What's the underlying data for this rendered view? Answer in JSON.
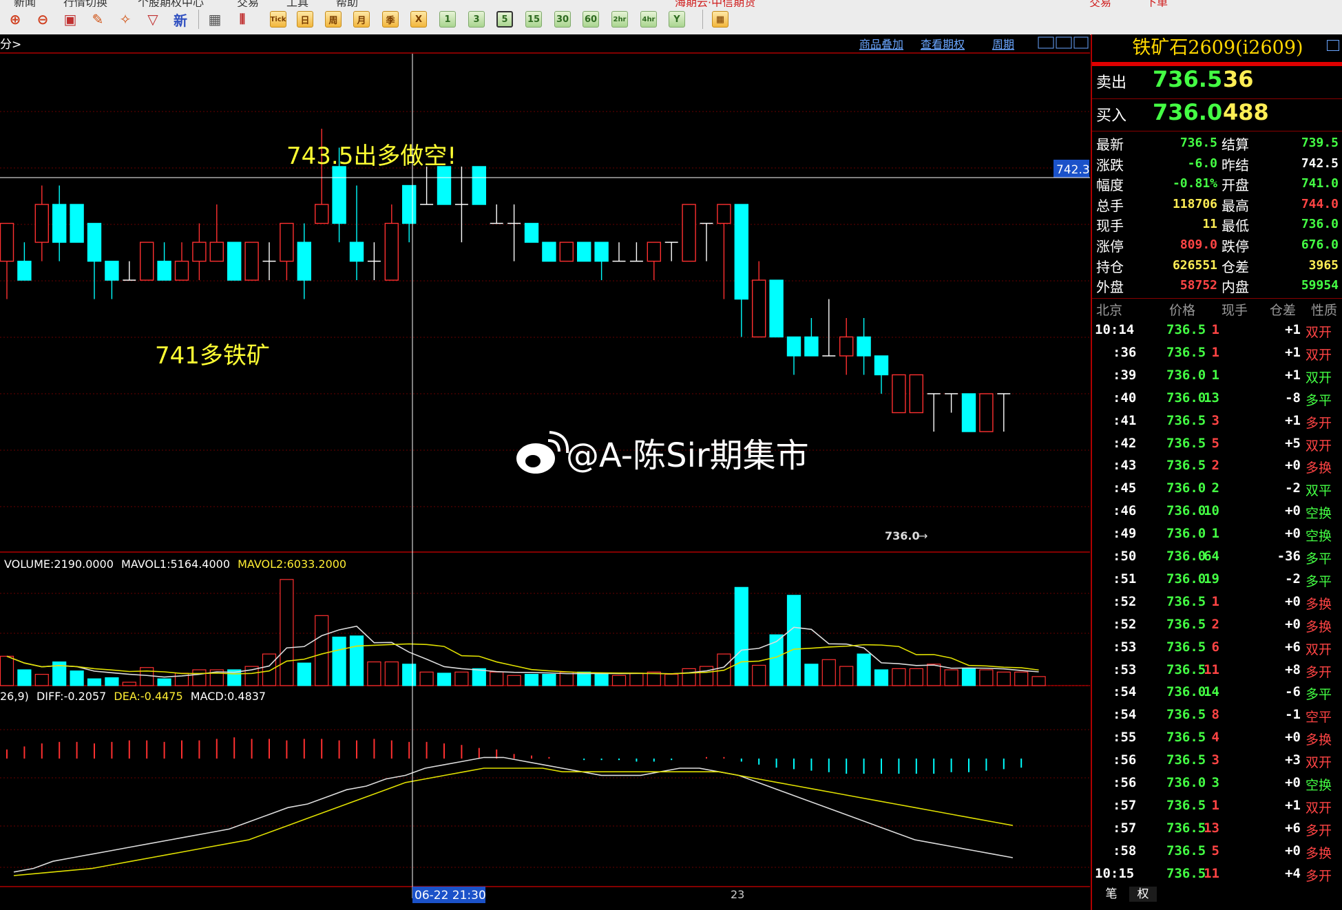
{
  "toolbar": {
    "menu_fragments": [
      "新闻",
      "行情切换",
      "个股期权中心",
      "交易",
      "工具",
      "帮助",
      "海期云·中信期货",
      "交易",
      "下单"
    ],
    "period_buttons": [
      "Tick",
      "日",
      "周",
      "月",
      "季",
      "X",
      "1",
      "3",
      "5",
      "15",
      "30",
      "60",
      "2hr",
      "4hr",
      "Y"
    ],
    "selected_period": "5",
    "accent_color": "#e0a020"
  },
  "chart_header": {
    "left_label": "分>",
    "links": [
      "商品叠加",
      "查看期权",
      "周期"
    ]
  },
  "chart_annotations": {
    "sell_note": "743.5出多做空!",
    "buy_note": "741多铁矿",
    "crosshair_price": "742.3",
    "last_price_marker": "736.0",
    "watermark": "@A-陈Sir期集市",
    "crosshair_time": "06-22 21:30",
    "date_label": "23"
  },
  "volume_indicator": {
    "volume": "VOLUME:2190.0000",
    "mavol1": "MAVOL1:5164.4000",
    "mavol2": "MAVOL2:6033.2000"
  },
  "macd_indicator": {
    "params": "26,9)",
    "diff": "DIFF:-0.2057",
    "dea": "DEA:-0.4475",
    "macd": "MACD:0.4837"
  },
  "chart_data": {
    "type": "candlestick",
    "price_range": [
      733,
      745
    ],
    "candles": [
      {
        "o": 740.5,
        "h": 741.5,
        "l": 739.5,
        "c": 741.5
      },
      {
        "o": 740.5,
        "h": 741.0,
        "l": 740.0,
        "c": 740.0
      },
      {
        "o": 741.0,
        "h": 742.5,
        "l": 740.5,
        "c": 742.0
      },
      {
        "o": 742.0,
        "h": 742.5,
        "l": 740.5,
        "c": 741.0
      },
      {
        "o": 742.0,
        "h": 742.0,
        "l": 741.0,
        "c": 741.0
      },
      {
        "o": 741.5,
        "h": 741.5,
        "l": 739.5,
        "c": 740.5
      },
      {
        "o": 740.5,
        "h": 740.5,
        "l": 739.5,
        "c": 740.0
      },
      {
        "o": 740.0,
        "h": 740.5,
        "l": 740.0,
        "c": 740.0
      },
      {
        "o": 740.0,
        "h": 741.0,
        "l": 740.0,
        "c": 741.0
      },
      {
        "o": 740.5,
        "h": 741.0,
        "l": 740.0,
        "c": 740.0
      },
      {
        "o": 740.0,
        "h": 741.0,
        "l": 740.0,
        "c": 740.5
      },
      {
        "o": 740.5,
        "h": 741.5,
        "l": 740.0,
        "c": 741.0
      },
      {
        "o": 740.5,
        "h": 742.0,
        "l": 740.5,
        "c": 741.0
      },
      {
        "o": 741.0,
        "h": 741.0,
        "l": 740.0,
        "c": 740.0
      },
      {
        "o": 740.0,
        "h": 741.0,
        "l": 740.0,
        "c": 741.0
      },
      {
        "o": 740.5,
        "h": 741.0,
        "l": 740.0,
        "c": 740.5
      },
      {
        "o": 740.5,
        "h": 741.5,
        "l": 740.0,
        "c": 741.5
      },
      {
        "o": 741.0,
        "h": 741.5,
        "l": 739.5,
        "c": 740.0
      },
      {
        "o": 741.5,
        "h": 744.0,
        "l": 741.5,
        "c": 742.0
      },
      {
        "o": 743.0,
        "h": 743.5,
        "l": 741.0,
        "c": 741.5
      },
      {
        "o": 741.0,
        "h": 742.5,
        "l": 740.0,
        "c": 740.5
      },
      {
        "o": 740.5,
        "h": 741.0,
        "l": 740.0,
        "c": 740.5
      },
      {
        "o": 740.0,
        "h": 742.0,
        "l": 740.0,
        "c": 741.5
      },
      {
        "o": 742.5,
        "h": 742.5,
        "l": 741.0,
        "c": 741.5
      },
      {
        "o": 742.0,
        "h": 743.0,
        "l": 742.0,
        "c": 742.0
      },
      {
        "o": 743.0,
        "h": 743.0,
        "l": 742.0,
        "c": 742.0
      },
      {
        "o": 742.0,
        "h": 743.0,
        "l": 741.0,
        "c": 742.0
      },
      {
        "o": 743.0,
        "h": 743.0,
        "l": 742.0,
        "c": 742.0
      },
      {
        "o": 741.5,
        "h": 742.0,
        "l": 741.5,
        "c": 741.5
      },
      {
        "o": 741.5,
        "h": 742.0,
        "l": 740.5,
        "c": 741.5
      },
      {
        "o": 741.5,
        "h": 741.5,
        "l": 741.0,
        "c": 741.0
      },
      {
        "o": 741.0,
        "h": 741.0,
        "l": 740.5,
        "c": 740.5
      },
      {
        "o": 740.5,
        "h": 741.0,
        "l": 740.5,
        "c": 741.0
      },
      {
        "o": 741.0,
        "h": 741.0,
        "l": 740.5,
        "c": 740.5
      },
      {
        "o": 741.0,
        "h": 741.0,
        "l": 740.0,
        "c": 740.5
      },
      {
        "o": 740.5,
        "h": 741.0,
        "l": 740.5,
        "c": 740.5
      },
      {
        "o": 740.5,
        "h": 741.0,
        "l": 740.5,
        "c": 740.5
      },
      {
        "o": 740.5,
        "h": 741.0,
        "l": 740.0,
        "c": 741.0
      },
      {
        "o": 741.0,
        "h": 741.0,
        "l": 740.5,
        "c": 741.0
      },
      {
        "o": 740.5,
        "h": 742.0,
        "l": 740.5,
        "c": 742.0
      },
      {
        "o": 741.5,
        "h": 741.5,
        "l": 740.5,
        "c": 741.5
      },
      {
        "o": 741.5,
        "h": 742.0,
        "l": 739.5,
        "c": 742.0
      },
      {
        "o": 742.0,
        "h": 742.0,
        "l": 738.5,
        "c": 739.5
      },
      {
        "o": 738.5,
        "h": 740.5,
        "l": 738.5,
        "c": 740.0
      },
      {
        "o": 740.0,
        "h": 740.0,
        "l": 738.5,
        "c": 738.5
      },
      {
        "o": 738.5,
        "h": 738.5,
        "l": 737.5,
        "c": 738.0
      },
      {
        "o": 738.5,
        "h": 739.0,
        "l": 738.0,
        "c": 738.0
      },
      {
        "o": 738.0,
        "h": 739.5,
        "l": 738.0,
        "c": 738.0
      },
      {
        "o": 738.0,
        "h": 739.0,
        "l": 737.5,
        "c": 738.5
      },
      {
        "o": 738.5,
        "h": 739.0,
        "l": 737.5,
        "c": 738.0
      },
      {
        "o": 738.0,
        "h": 738.0,
        "l": 737.0,
        "c": 737.5
      },
      {
        "o": 736.5,
        "h": 737.5,
        "l": 736.5,
        "c": 737.5
      },
      {
        "o": 736.5,
        "h": 737.5,
        "l": 736.5,
        "c": 737.5
      },
      {
        "o": 737.0,
        "h": 737.0,
        "l": 736.0,
        "c": 737.0
      },
      {
        "o": 737.0,
        "h": 737.0,
        "l": 736.5,
        "c": 737.0
      },
      {
        "o": 737.0,
        "h": 737.0,
        "l": 736.0,
        "c": 736.0
      },
      {
        "o": 736.0,
        "h": 737.0,
        "l": 736.0,
        "c": 737.0
      },
      {
        "o": 737.0,
        "h": 737.0,
        "l": 736.0,
        "c": 737.0
      }
    ],
    "volumes": [
      2600,
      1400,
      1000,
      2100,
      1300,
      600,
      700,
      300,
      1600,
      600,
      1100,
      1400,
      1400,
      1400,
      1700,
      2800,
      9400,
      2000,
      6200,
      4300,
      4400,
      2100,
      2100,
      1900,
      1200,
      1100,
      1200,
      1500,
      1200,
      900,
      1000,
      1000,
      1200,
      1200,
      1000,
      900,
      1100,
      1200,
      1000,
      1500,
      1700,
      2800,
      8700,
      1800,
      4500,
      8000,
      1900,
      2300,
      1700,
      2800,
      1400,
      1500,
      1500,
      1900,
      1400,
      1500,
      1400,
      1200,
      1200,
      800
    ],
    "macd_bars": [
      0.6,
      0.8,
      1.0,
      1.1,
      1.1,
      1.0,
      1.1,
      1.2,
      1.2,
      1.1,
      1.2,
      1.2,
      1.3,
      1.4,
      1.3,
      1.3,
      1.2,
      1.3,
      1.3,
      1.2,
      1.2,
      1.3,
      1.2,
      1.1,
      1.1,
      1.0,
      0.9,
      0.7,
      0.6,
      0.3,
      0.2,
      0.1,
      0.0,
      -0.1,
      -0.1,
      -0.1,
      -0.2,
      -0.2,
      -0.1,
      0.0,
      0.1,
      0.1,
      -0.2,
      -0.4,
      -0.6,
      -0.7,
      -0.8,
      -0.9,
      -1.0,
      -1.0,
      -1.0,
      -1.0,
      -1.0,
      -1.0,
      -0.9,
      -0.9,
      -0.8,
      -0.7,
      -0.6
    ],
    "diff_line": [
      -0.9,
      -0.8,
      -0.6,
      -0.5,
      -0.4,
      -0.3,
      -0.2,
      -0.1,
      0.0,
      0.1,
      0.2,
      0.3,
      0.5,
      0.7,
      0.9,
      1.0,
      1.2,
      1.4,
      1.5,
      1.7,
      1.8,
      2.0,
      2.1,
      2.2,
      2.3,
      2.3,
      2.2,
      2.1,
      2.0,
      1.9,
      1.8,
      1.8,
      1.8,
      1.9,
      2.0,
      2.0,
      1.9,
      1.8,
      1.6,
      1.4,
      1.2,
      1.0,
      0.8,
      0.6,
      0.4,
      0.2,
      0.0,
      -0.1,
      -0.2,
      -0.3,
      -0.4,
      -0.5
    ],
    "dea_line": [
      -1.0,
      -0.95,
      -0.9,
      -0.85,
      -0.8,
      -0.7,
      -0.6,
      -0.5,
      -0.4,
      -0.3,
      -0.2,
      -0.1,
      0.0,
      0.2,
      0.4,
      0.6,
      0.8,
      1.0,
      1.2,
      1.4,
      1.6,
      1.7,
      1.8,
      1.9,
      2.0,
      2.0,
      2.0,
      2.0,
      1.9,
      1.9,
      1.9,
      1.9,
      1.9,
      1.9,
      1.9,
      1.9,
      1.9,
      1.8,
      1.7,
      1.6,
      1.5,
      1.4,
      1.3,
      1.2,
      1.1,
      1.0,
      0.9,
      0.8,
      0.7,
      0.6,
      0.5,
      0.4
    ]
  },
  "quote_panel": {
    "title": "铁矿石2609(i2609)",
    "sell_label": "卖出",
    "sell_price": "736.5",
    "sell_volume": "36",
    "buy_label": "买入",
    "buy_price": "736.0",
    "buy_volume": "488",
    "stats": [
      {
        "l1": "最新",
        "v1": "736.5",
        "c1": "#44ff44",
        "l2": "结算",
        "v2": "739.5",
        "c2": "#44ff44"
      },
      {
        "l1": "涨跌",
        "v1": "-6.0",
        "c1": "#44ff44",
        "l2": "昨结",
        "v2": "742.5",
        "c2": "#ffffff"
      },
      {
        "l1": "幅度",
        "v1": "-0.81%",
        "c1": "#44ff44",
        "l2": "开盘",
        "v2": "741.0",
        "c2": "#44ff44"
      },
      {
        "l1": "总手",
        "v1": "118706",
        "c1": "#ffee55",
        "l2": "最高",
        "v2": "744.0",
        "c2": "#ff4444"
      },
      {
        "l1": "现手",
        "v1": "11",
        "c1": "#ffee55",
        "l2": "最低",
        "v2": "736.0",
        "c2": "#44ff44"
      },
      {
        "l1": "涨停",
        "v1": "809.0",
        "c1": "#ff4444",
        "l2": "跌停",
        "v2": "676.0",
        "c2": "#44ff44"
      },
      {
        "l1": "持仓",
        "v1": "626551",
        "c1": "#ffee55",
        "l2": "仓差",
        "v2": "3965",
        "c2": "#ffee55"
      },
      {
        "l1": "外盘",
        "v1": "58752",
        "c1": "#ff4444",
        "l2": "内盘",
        "v2": "59954",
        "c2": "#44ff44"
      }
    ],
    "tick_headers": [
      "北京",
      "价格",
      "现手",
      "仓差",
      "性质"
    ],
    "ticks": [
      {
        "t": "10:14",
        "p": "736.5",
        "v": "1",
        "d": "+1",
        "n": "双开",
        "nc": "#ff4444"
      },
      {
        "t": ":36",
        "p": "736.5",
        "v": "1",
        "d": "+1",
        "n": "双开",
        "nc": "#ff4444"
      },
      {
        "t": ":39",
        "p": "736.0",
        "v": "1",
        "d": "+1",
        "n": "双开",
        "nc": "#44ff44"
      },
      {
        "t": ":40",
        "p": "736.0",
        "v": "13",
        "d": "-8",
        "n": "多平",
        "nc": "#44ff44"
      },
      {
        "t": ":41",
        "p": "736.5",
        "v": "3",
        "d": "+1",
        "n": "多开",
        "nc": "#ff4444"
      },
      {
        "t": ":42",
        "p": "736.5",
        "v": "5",
        "d": "+5",
        "n": "双开",
        "nc": "#ff4444"
      },
      {
        "t": ":43",
        "p": "736.5",
        "v": "2",
        "d": "+0",
        "n": "多换",
        "nc": "#ff4444"
      },
      {
        "t": ":45",
        "p": "736.0",
        "v": "2",
        "d": "-2",
        "n": "双平",
        "nc": "#44ff44"
      },
      {
        "t": ":46",
        "p": "736.0",
        "v": "10",
        "d": "+0",
        "n": "空换",
        "nc": "#44ff44"
      },
      {
        "t": ":49",
        "p": "736.0",
        "v": "1",
        "d": "+0",
        "n": "空换",
        "nc": "#44ff44"
      },
      {
        "t": ":50",
        "p": "736.0",
        "v": "64",
        "d": "-36",
        "n": "多平",
        "nc": "#44ff44"
      },
      {
        "t": ":51",
        "p": "736.0",
        "v": "19",
        "d": "-2",
        "n": "多平",
        "nc": "#44ff44"
      },
      {
        "t": ":52",
        "p": "736.5",
        "v": "1",
        "d": "+0",
        "n": "多换",
        "nc": "#ff4444"
      },
      {
        "t": ":52",
        "p": "736.5",
        "v": "2",
        "d": "+0",
        "n": "多换",
        "nc": "#ff4444"
      },
      {
        "t": ":53",
        "p": "736.5",
        "v": "6",
        "d": "+6",
        "n": "双开",
        "nc": "#ff4444"
      },
      {
        "t": ":53",
        "p": "736.5",
        "v": "11",
        "d": "+8",
        "n": "多开",
        "nc": "#ff4444"
      },
      {
        "t": ":54",
        "p": "736.0",
        "v": "14",
        "d": "-6",
        "n": "多平",
        "nc": "#44ff44"
      },
      {
        "t": ":54",
        "p": "736.5",
        "v": "8",
        "d": "-1",
        "n": "空平",
        "nc": "#ff4444"
      },
      {
        "t": ":55",
        "p": "736.5",
        "v": "4",
        "d": "+0",
        "n": "多换",
        "nc": "#ff4444"
      },
      {
        "t": ":56",
        "p": "736.5",
        "v": "3",
        "d": "+3",
        "n": "双开",
        "nc": "#ff4444"
      },
      {
        "t": ":56",
        "p": "736.0",
        "v": "3",
        "d": "+0",
        "n": "空换",
        "nc": "#44ff44"
      },
      {
        "t": ":57",
        "p": "736.5",
        "v": "1",
        "d": "+1",
        "n": "双开",
        "nc": "#ff4444"
      },
      {
        "t": ":57",
        "p": "736.5",
        "v": "13",
        "d": "+6",
        "n": "多开",
        "nc": "#ff4444"
      },
      {
        "t": ":58",
        "p": "736.5",
        "v": "5",
        "d": "+0",
        "n": "多换",
        "nc": "#ff4444"
      },
      {
        "t": "10:15",
        "p": "736.5",
        "v": "11",
        "d": "+4",
        "n": "多开",
        "nc": "#ff4444"
      }
    ],
    "tabs": [
      "笔",
      "权"
    ]
  }
}
